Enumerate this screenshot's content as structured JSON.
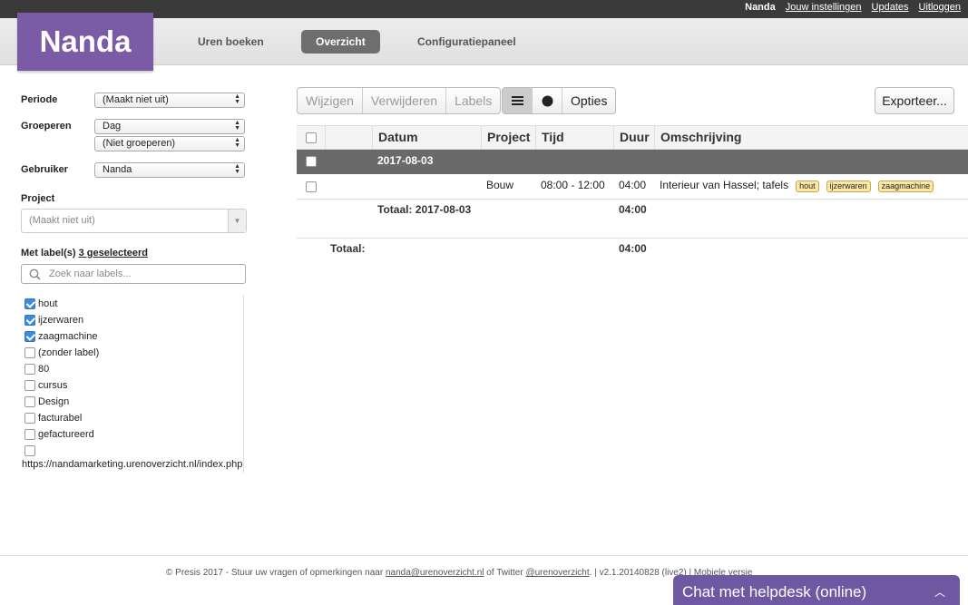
{
  "topbar": {
    "user": "Nanda",
    "links": [
      "Jouw instellingen",
      "Updates",
      "Uitloggen"
    ]
  },
  "nav": {
    "logo": "Nanda",
    "tabs": [
      "Uren boeken",
      "Overzicht",
      "Configuratiepaneel"
    ],
    "active_tab": "Overzicht"
  },
  "filters": {
    "periode_label": "Periode",
    "periode_value": "(Maakt niet uit)",
    "groeperen_label": "Groeperen",
    "groeperen_value1": "Dag",
    "groeperen_value2": "(Niet groeperen)",
    "gebruiker_label": "Gebruiker",
    "gebruiker_value": "Nanda",
    "project_label": "Project",
    "project_placeholder": "(Maakt niet uit)",
    "labels_heading": "Met label(s)",
    "labels_selected": "3 geselecteerd",
    "labels_search_placeholder": "Zoek naar labels...",
    "labels": [
      {
        "name": "hout",
        "checked": true
      },
      {
        "name": "ijzerwaren",
        "checked": true
      },
      {
        "name": "zaagmachine",
        "checked": true
      },
      {
        "name": "(zonder label)",
        "checked": false
      },
      {
        "name": "80",
        "checked": false
      },
      {
        "name": "cursus",
        "checked": false
      },
      {
        "name": "Design",
        "checked": false
      },
      {
        "name": "facturabel",
        "checked": false
      },
      {
        "name": "gefactureerd",
        "checked": false
      },
      {
        "name": "",
        "checked": false
      }
    ],
    "overflow_url": "https://nandamarketing.urenoverzicht.nl/index.php?/"
  },
  "toolbar": {
    "wijzigen": "Wijzigen",
    "verwijderen": "Verwijderen",
    "labels": "Labels",
    "list_view_icon": "list-icon",
    "chart_view_icon": "pie-chart-icon",
    "opties": "Opties",
    "exporteer": "Exporteer..."
  },
  "table": {
    "headers": [
      "Datum",
      "Project",
      "Tijd",
      "Duur",
      "Omschrijving"
    ],
    "group_date": "2017-08-03",
    "rows": [
      {
        "project": "Bouw",
        "tijd": "08:00 - 12:00",
        "duur": "04:00",
        "omschrijving": "Interieur van Hassel; tafels",
        "tags": [
          "hout",
          "ijzerwaren",
          "zaagmachine"
        ]
      }
    ],
    "subtotal_label": "Totaal: 2017-08-03",
    "subtotal_value": "04:00",
    "total_label": "Totaal:",
    "total_value": "04:00"
  },
  "footer": {
    "text1": "© Presis 2017 - Stuur uw vragen of opmerkingen naar",
    "email": "nanda@urenoverzicht.nl",
    "text2": "of Twitter",
    "twitter": "@urenoverzicht",
    "text3": ".   |  v2.1.20140828 (live2)  |  Mobiele versie"
  },
  "chat": {
    "label": "Chat met helpdesk (online)"
  },
  "colors": {
    "brand": "#7b5ba6",
    "chat": "#6e58a2",
    "group_row": "#6a6a6a",
    "tag_bg": "#fbe6a5"
  }
}
